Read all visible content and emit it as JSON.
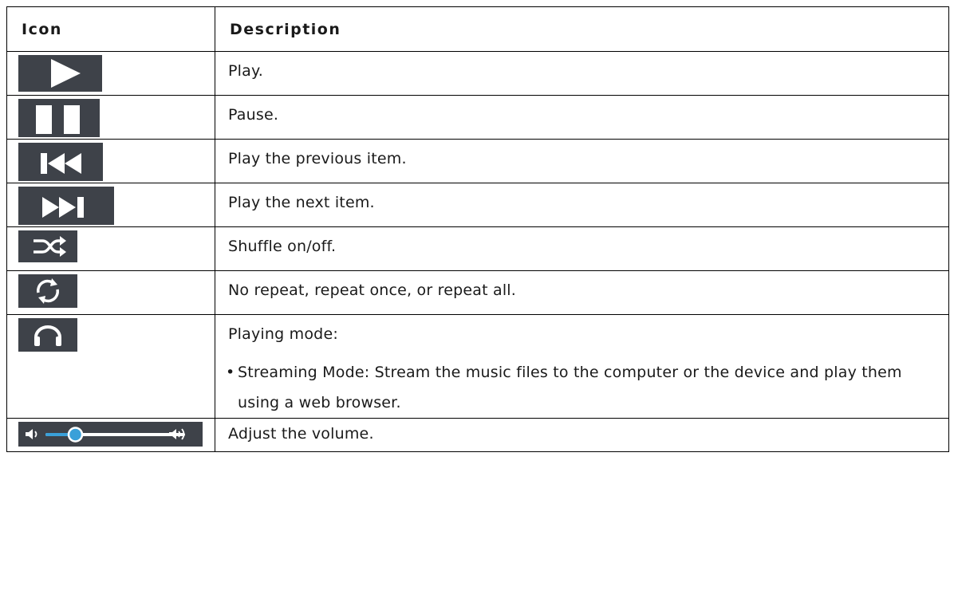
{
  "header": {
    "icon": "Icon",
    "description": "Description"
  },
  "rows": [
    {
      "icon": "play-icon",
      "text": "Play."
    },
    {
      "icon": "pause-icon",
      "text": "Pause."
    },
    {
      "icon": "previous-icon",
      "text": "Play the previous item."
    },
    {
      "icon": "next-icon",
      "text": "Play the next item."
    },
    {
      "icon": "shuffle-icon",
      "text": "Shuffle on/off."
    },
    {
      "icon": "repeat-icon",
      "text": "No repeat, repeat once, or repeat all."
    },
    {
      "icon": "headphones-icon",
      "text": "Playing mode:",
      "bullets": [
        "Streaming Mode: Stream the music files to the computer or the device and play them using a web browser."
      ]
    },
    {
      "icon": "volume-slider-icon",
      "text": "Adjust the volume.",
      "volume_level": 0.25
    }
  ],
  "colors": {
    "icon_bg": "#3e4249",
    "icon_fg": "#ffffff",
    "volume_fill": "#3aa0d9"
  }
}
